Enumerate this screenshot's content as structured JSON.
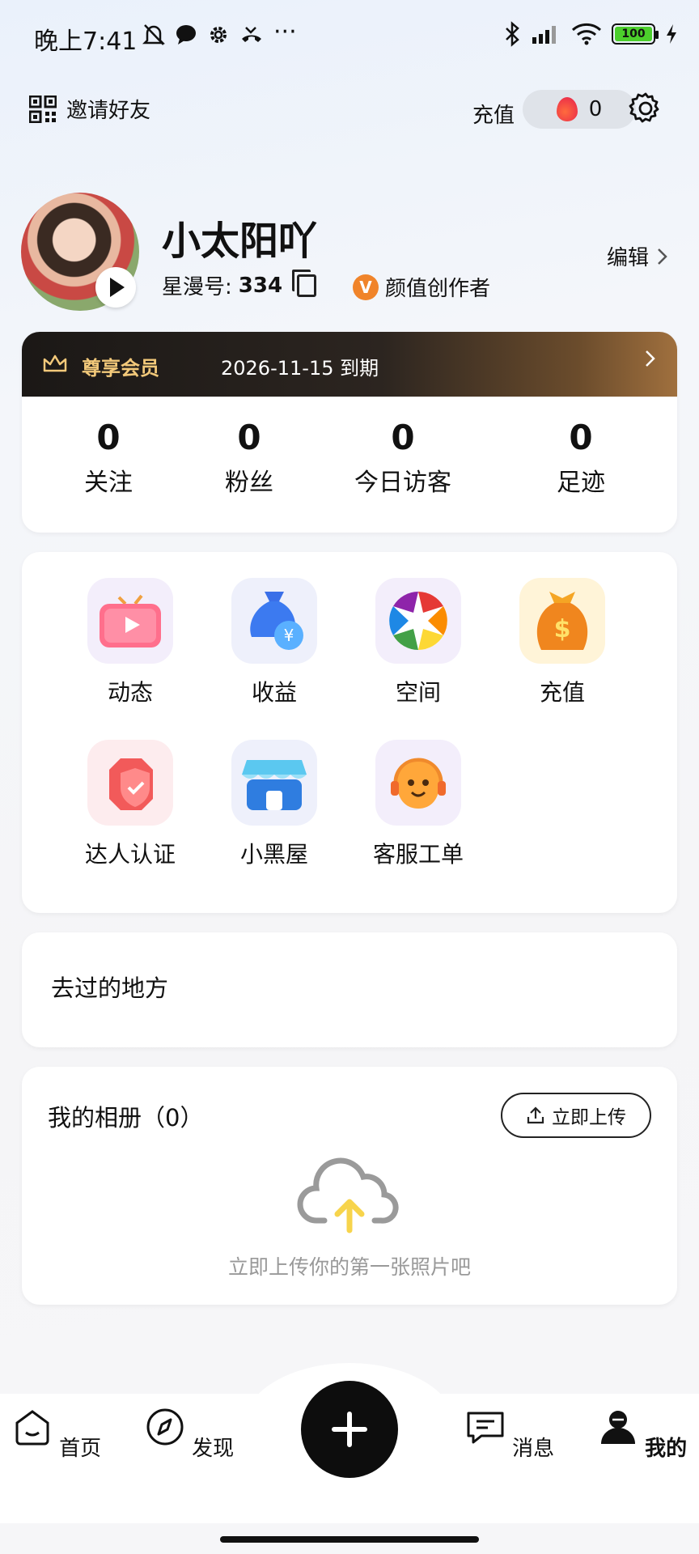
{
  "status_bar": {
    "time": "晚上7:41",
    "battery": "100"
  },
  "top": {
    "invite_label": "邀请好友",
    "recharge_label": "充值",
    "coin_count": "0"
  },
  "profile": {
    "nickname": "小太阳吖",
    "id_label": "星漫号:",
    "id_value": "334",
    "creator_badge": "V",
    "creator_label": "颜值创作者",
    "edit_label": "编辑"
  },
  "member": {
    "title": "尊享会员",
    "expire": "2026-11-15 到期",
    "stats": [
      {
        "value": "0",
        "label": "关注"
      },
      {
        "value": "0",
        "label": "粉丝"
      },
      {
        "value": "0",
        "label": "今日访客"
      },
      {
        "value": "0",
        "label": "足迹"
      }
    ]
  },
  "features": [
    {
      "label": "动态",
      "icon": "tv-play-icon"
    },
    {
      "label": "收益",
      "icon": "money-bag-icon"
    },
    {
      "label": "空间",
      "icon": "aperture-icon"
    },
    {
      "label": "充值",
      "icon": "gold-bag-icon"
    },
    {
      "label": "达人认证",
      "icon": "shield-check-icon"
    },
    {
      "label": "小黑屋",
      "icon": "store-icon"
    },
    {
      "label": "客服工单",
      "icon": "support-mascot-icon"
    }
  ],
  "places": {
    "title": "去过的地方"
  },
  "album": {
    "title": "我的相册（0）",
    "upload_label": "立即上传",
    "hint": "立即上传你的第一张照片吧"
  },
  "tabs": [
    {
      "label": "首页",
      "icon": "home-icon"
    },
    {
      "label": "发现",
      "icon": "compass-icon"
    },
    {
      "label": "消息",
      "icon": "message-icon"
    },
    {
      "label": "我的",
      "icon": "user-icon"
    }
  ],
  "colors": {
    "accent": "#0d0d0d",
    "vip_gold": "#f3c97a",
    "creator_orange": "#f0842a"
  }
}
